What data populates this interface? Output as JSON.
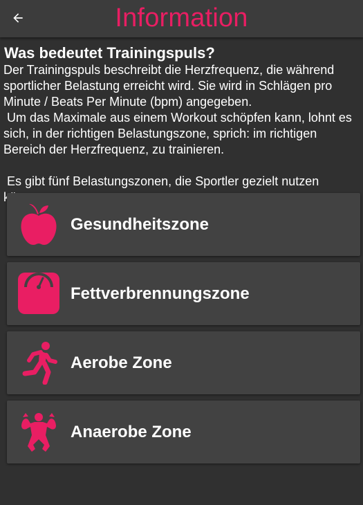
{
  "colors": {
    "accent": "#e91e63",
    "background": "#303030",
    "appbar": "#3c3c3c",
    "card": "#424242",
    "text": "#ffffff"
  },
  "appbar": {
    "title": "Information",
    "back_icon": "arrow-back-icon"
  },
  "info": {
    "heading": "Was bedeutet Trainingspuls?",
    "paragraph1": "Der Trainingspuls beschreibt die Herzfrequenz, die während sportlicher Belastung erreicht wird. Sie wird in Schlägen pro Minute / Beats Per Minute (bpm) angegeben.",
    "paragraph2": " Um das Maximale aus einem Workout schöpfen kann, lohnt es sich, in der richtigen Belastungszone, sprich: im richtigen Bereich der Herzfrequenz, zu trainieren.",
    "paragraph3": " Es gibt fünf Belastungszonen, die Sportler gezielt nutzen können:"
  },
  "zones": [
    {
      "label": "Gesundheitszone",
      "icon": "apple-icon"
    },
    {
      "label": "Fettverbrennungszone",
      "icon": "scale-icon"
    },
    {
      "label": "Aerobe Zone",
      "icon": "running-person-icon"
    },
    {
      "label": "Anaerobe Zone",
      "icon": "muscle-man-icon"
    }
  ]
}
